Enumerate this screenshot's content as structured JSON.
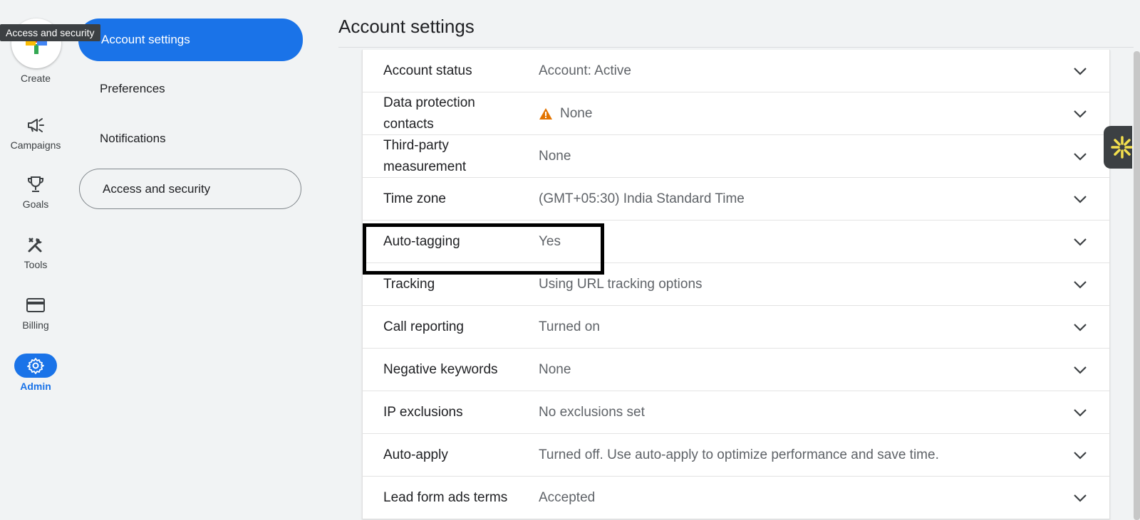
{
  "tooltip": {
    "text": "Access and security"
  },
  "rail": {
    "create_label": "Create",
    "items": [
      {
        "label": "Campaigns",
        "icon": "megaphone-icon"
      },
      {
        "label": "Goals",
        "icon": "trophy-icon"
      },
      {
        "label": "Tools",
        "icon": "tools-icon"
      },
      {
        "label": "Billing",
        "icon": "credit-card-icon"
      },
      {
        "label": "Admin",
        "icon": "gear-icon",
        "active": true
      }
    ]
  },
  "subnav": {
    "items": [
      {
        "label": "Account settings",
        "selected": true
      },
      {
        "label": "Preferences"
      },
      {
        "label": "Notifications"
      },
      {
        "label": "Access and security",
        "outlined": true
      }
    ]
  },
  "main": {
    "title": "Account settings",
    "rows": [
      {
        "label": "Account status",
        "value": "Account: Active"
      },
      {
        "label": "Data protection contacts",
        "value": "None",
        "warning": true
      },
      {
        "label": "Third-party measurement",
        "value": "None"
      },
      {
        "label": "Time zone",
        "value": "(GMT+05:30) India Standard Time"
      },
      {
        "label": "Auto-tagging",
        "value": "Yes"
      },
      {
        "label": "Tracking",
        "value": "Using URL tracking options"
      },
      {
        "label": "Call reporting",
        "value": "Turned on"
      },
      {
        "label": "Negative keywords",
        "value": "None"
      },
      {
        "label": "IP exclusions",
        "value": "No exclusions set"
      },
      {
        "label": "Auto-apply",
        "value": "Turned off. Use auto-apply to optimize performance and save time."
      },
      {
        "label": "Lead form ads terms",
        "value": "Accepted"
      }
    ]
  },
  "colors": {
    "accent": "#1a73e8",
    "warning": "#e37400",
    "helper_icon": "#f4e04d"
  }
}
